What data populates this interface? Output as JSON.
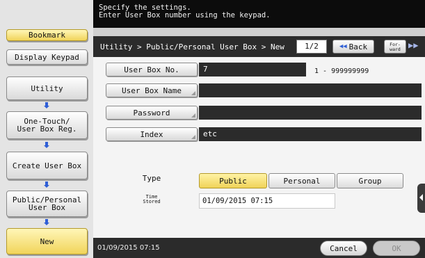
{
  "sidebar": {
    "bookmark_label": "Bookmark",
    "display_keypad_label": "Display Keypad",
    "nav": [
      "Utility",
      "One-Touch/\nUser Box Reg.",
      "Create User Box",
      "Public/Personal\nUser Box",
      "New"
    ]
  },
  "message": {
    "line1": "Specify the settings.",
    "line2": "Enter User Box number using the keypad."
  },
  "header": {
    "breadcrumb": "Utility > Public/Personal User Box > New",
    "page": "1/2",
    "back_label": "Back",
    "forward_label": "For-\nward"
  },
  "form": {
    "user_box_no_label": "User Box No.",
    "user_box_no_value": "7",
    "range": "1 - 999999999",
    "user_box_name_label": "User Box Name",
    "user_box_name_value": "",
    "password_label": "Password",
    "password_value": "",
    "index_label": "Index",
    "index_value": "etc",
    "type_label": "Type",
    "type_options": [
      "Public",
      "Personal",
      "Group"
    ],
    "type_selected": "Public",
    "time_stored_label": "Time\nStored",
    "time_stored_value": "01/09/2015   07:15"
  },
  "footer": {
    "datetime": "01/09/2015  07:15",
    "cancel_label": "Cancel",
    "ok_label": "OK"
  },
  "colors": {
    "selected": "#f0d358",
    "arrow": "#2f5fd6",
    "dark_bar": "#2b2b2b"
  },
  "icons": [
    "back-arrow-icon",
    "forward-arrow-icon",
    "down-arrow-icon",
    "expand-panel-icon",
    "corner-indicator-icon"
  ]
}
